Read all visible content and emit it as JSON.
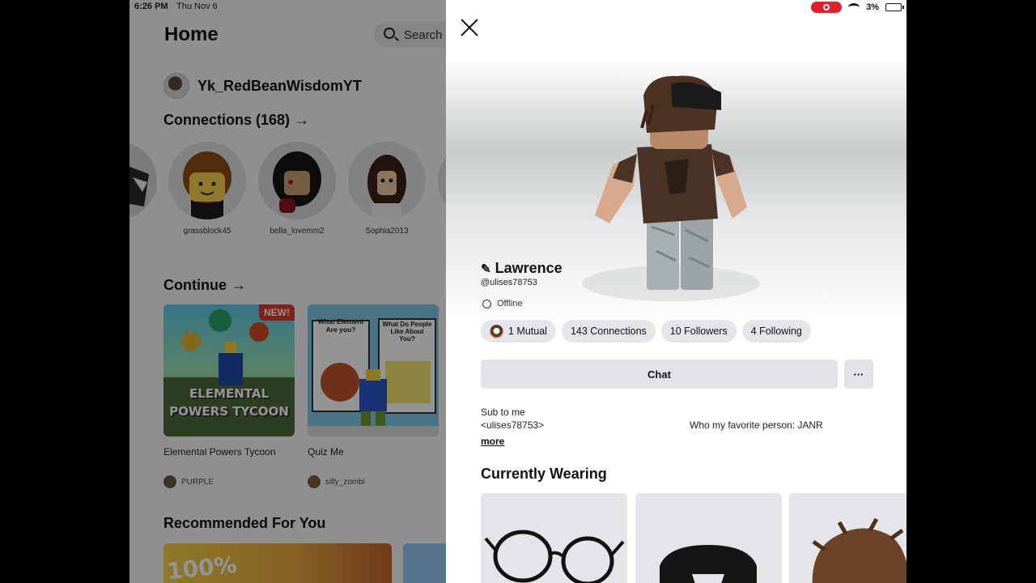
{
  "status_bar": {
    "time": "6:26 PM",
    "date": "Thu Nov 6",
    "battery": "3%"
  },
  "home": {
    "title": "Home",
    "search_label": "Search",
    "me_name": "Yk_RedBeanWisdomYT",
    "connections_heading": "Connections (168)",
    "connections": [
      {
        "name": "grassblock45"
      },
      {
        "name": "bella_lovemm2"
      },
      {
        "name": "Sophia2013"
      }
    ],
    "continue_heading": "Continue",
    "games": [
      {
        "title": "Elemental Powers Tycoon",
        "badge": "NEW!",
        "thumb_text": "ELEMENTAL POWERS TYCOON",
        "creator": "PURPLE"
      },
      {
        "title": "Quiz Me",
        "thumb_left": "What Element Are you?",
        "thumb_right": "What Do People Like About You?",
        "creator": "silly_zombi"
      }
    ],
    "recommended_heading": "Recommended For You",
    "rec_thumb_text": "100%"
  },
  "profile": {
    "display_name": "Lawrence",
    "username": "@ulises78753",
    "status": "Offline",
    "stats": {
      "mutual": "1 Mutual",
      "connections": "143 Connections",
      "followers": "10 Followers",
      "following": "4 Following"
    },
    "chat_label": "Chat",
    "more_label": "···",
    "bio_line1": "Sub to me",
    "bio_line2": "<ulises78753>",
    "bio_line3": "Who my favorite person: JANR",
    "more_link": "more",
    "currently_wearing_heading": "Currently Wearing"
  }
}
